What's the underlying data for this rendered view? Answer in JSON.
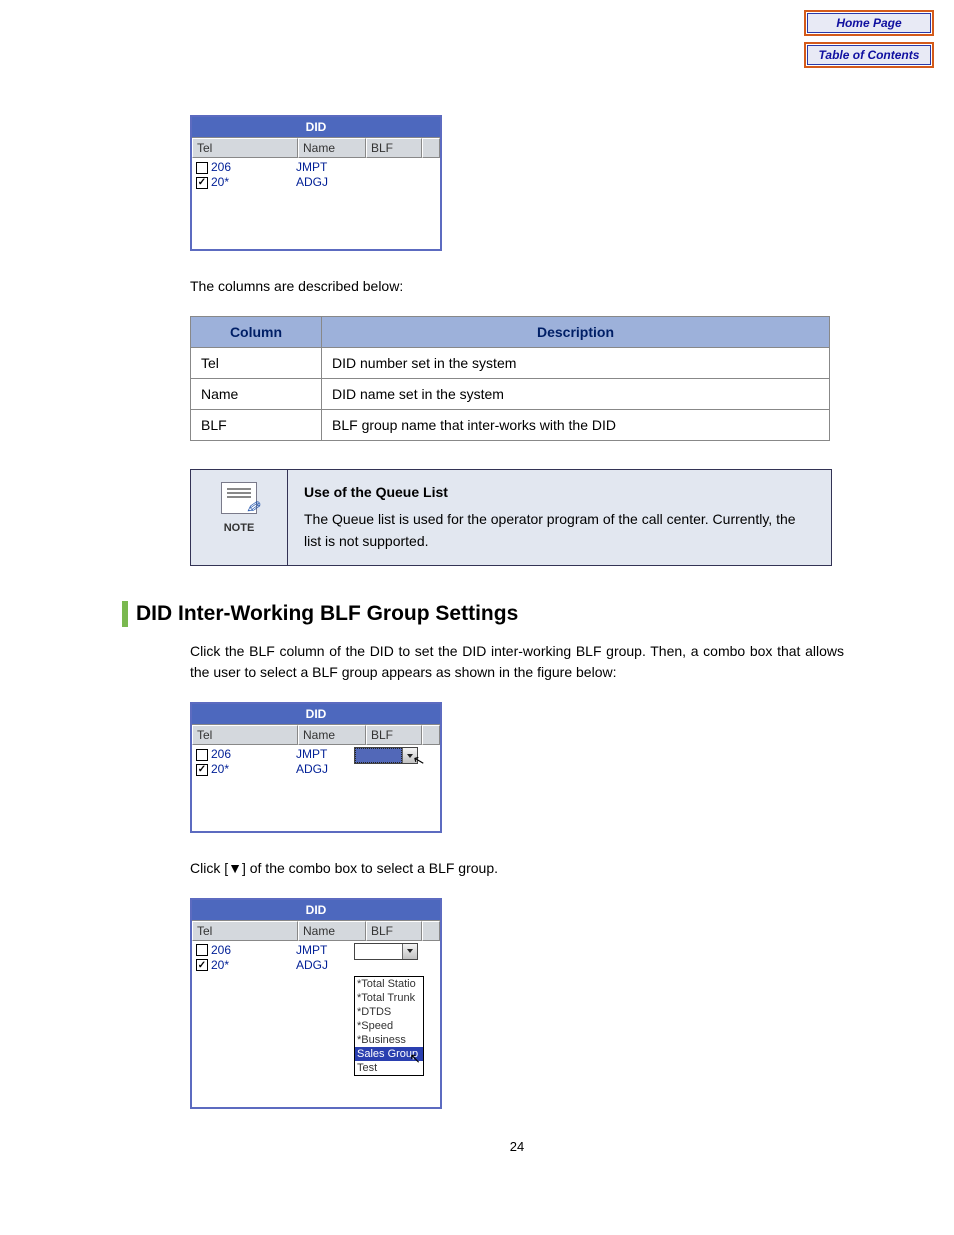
{
  "nav": {
    "home": "Home Page",
    "toc": "Table of Contents"
  },
  "did": {
    "title": "DID",
    "headers": {
      "tel": "Tel",
      "name": "Name",
      "blf": "BLF"
    },
    "rows": [
      {
        "checked": false,
        "tel": "206",
        "name": "JMPT"
      },
      {
        "checked": true,
        "tel": "20*",
        "name": "ADGJ"
      }
    ]
  },
  "columns_intro": "The columns are described below:",
  "desc_table": {
    "th1": "Column",
    "th2": "Description",
    "rows": [
      {
        "c": "Tel",
        "d": "DID number set in the system"
      },
      {
        "c": "Name",
        "d": "DID name set in the system"
      },
      {
        "c": "BLF",
        "d": "BLF group name that inter-works with the DID"
      }
    ]
  },
  "note": {
    "label": "NOTE",
    "title": "Use of the Queue List",
    "body": "The Queue list is used for the operator program of the call center. Currently, the list is not supported."
  },
  "section": {
    "title": "DID Inter-Working BLF Group Settings",
    "p1": "Click the BLF column of the DID to set the DID inter-working BLF group. Then, a combo box that allows the user to select a BLF group appears as shown in the figure below:",
    "p2": "Click [▼] of the combo box to select a BLF group."
  },
  "dropdown": {
    "items": [
      "*Total Statio",
      "*Total Trunk",
      "*DTDS",
      "*Speed",
      "*Business",
      "Sales Group",
      "Test"
    ],
    "selected_index": 5
  },
  "page_number": "24"
}
